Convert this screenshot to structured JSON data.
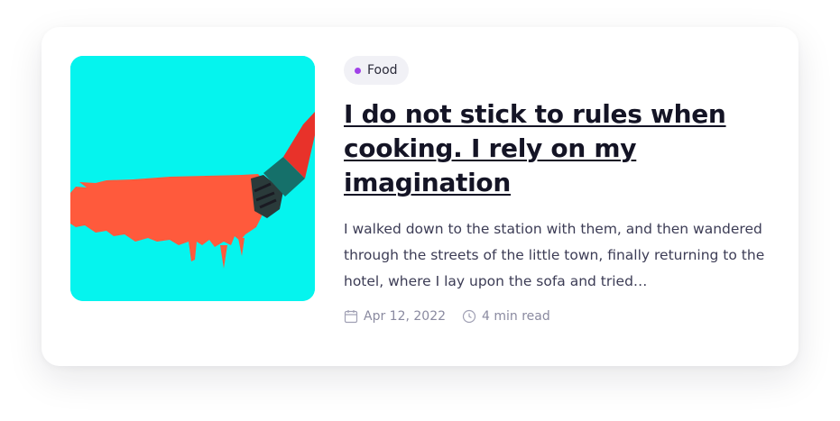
{
  "card": {
    "category": "Food",
    "title": "I do not stick to rules when cooking. I rely on my imagination",
    "excerpt": "I walked down to the station with them, and then wandered through the streets of the little town, finally returning to the hotel, where I lay upon the sofa and tried…",
    "date": "Apr 12, 2022",
    "read_time": "4 min read"
  },
  "colors": {
    "image_background": "#05f4ee",
    "paint_stroke": "#ff5a3c",
    "category_dot": "#a142e8"
  },
  "icons": {
    "date": "calendar-icon",
    "read_time": "clock-icon"
  }
}
